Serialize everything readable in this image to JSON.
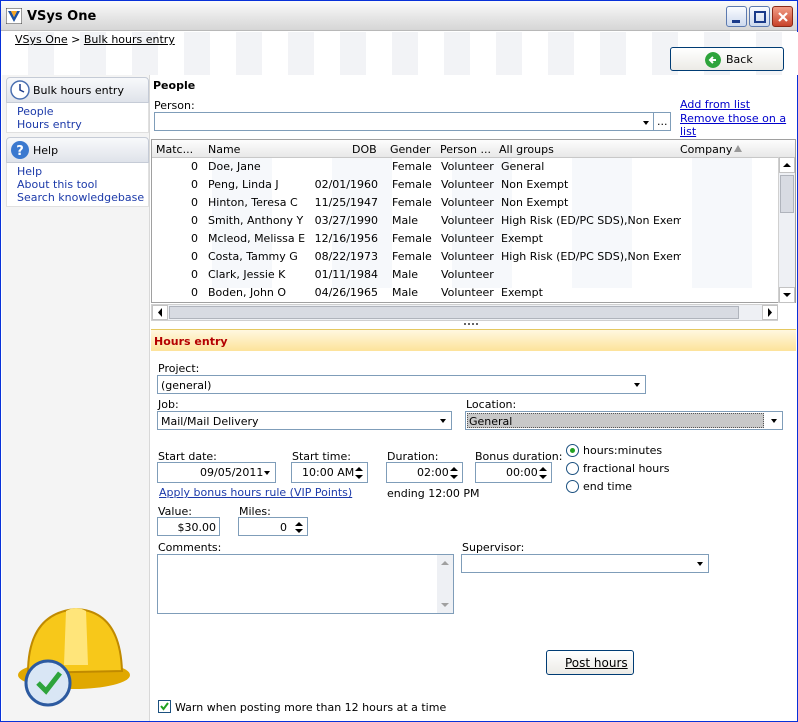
{
  "window": {
    "title": "VSys One"
  },
  "breadcrumb": {
    "root": "VSys One",
    "separator": ">",
    "current": "Bulk hours entry"
  },
  "toolbar": {
    "back_label": "Back"
  },
  "sidebar": {
    "sections": [
      {
        "title": "Bulk hours entry",
        "icon": "clock-icon",
        "links": [
          "People",
          "Hours entry"
        ]
      },
      {
        "title": "Help",
        "icon": "help-icon",
        "links": [
          "Help",
          "About this tool",
          "Search knowledgebase"
        ]
      }
    ]
  },
  "people": {
    "title": "People",
    "person_label": "Person:",
    "person_value": "",
    "more_label": "...",
    "add_from_list": "Add from list",
    "remove_on_list": "Remove those on a list",
    "columns": [
      "Matc...",
      "Name",
      "DOB",
      "Gender",
      "Person ...",
      "All groups",
      "Company"
    ],
    "rows": [
      {
        "match": "0",
        "name": "Doe, Jane",
        "dob": "",
        "gender": "Female",
        "type": "Volunteer",
        "groups": "General",
        "company": ""
      },
      {
        "match": "0",
        "name": "Peng, Linda J",
        "dob": "02/01/1960",
        "gender": "Female",
        "type": "Volunteer",
        "groups": "Non Exempt",
        "company": ""
      },
      {
        "match": "0",
        "name": "Hinton, Teresa C",
        "dob": "11/25/1947",
        "gender": "Female",
        "type": "Volunteer",
        "groups": "Non Exempt",
        "company": ""
      },
      {
        "match": "0",
        "name": "Smith, Anthony Y",
        "dob": "03/27/1990",
        "gender": "Male",
        "type": "Volunteer",
        "groups": "High Risk (ED/PC SDS),Non Exempt",
        "company": ""
      },
      {
        "match": "0",
        "name": "Mcleod, Melissa E",
        "dob": "12/16/1956",
        "gender": "Female",
        "type": "Volunteer",
        "groups": "Exempt",
        "company": ""
      },
      {
        "match": "0",
        "name": "Costa, Tammy G",
        "dob": "08/22/1973",
        "gender": "Female",
        "type": "Volunteer",
        "groups": "High Risk (ED/PC SDS),Non Exempt",
        "company": ""
      },
      {
        "match": "0",
        "name": "Clark, Jessie K",
        "dob": "01/11/1984",
        "gender": "Male",
        "type": "Volunteer",
        "groups": "",
        "company": ""
      },
      {
        "match": "0",
        "name": "Boden, John O",
        "dob": "04/26/1965",
        "gender": "Male",
        "type": "Volunteer",
        "groups": "Exempt",
        "company": ""
      }
    ]
  },
  "hours": {
    "title": "Hours entry",
    "project_label": "Project:",
    "project_value": "(general)",
    "job_label": "Job:",
    "job_value": "Mail/Mail Delivery",
    "location_label": "Location:",
    "location_value": "General",
    "start_date_label": "Start date:",
    "start_date_value": "09/05/2011",
    "start_time_label": "Start time:",
    "start_time_value": "10:00 AM",
    "duration_label": "Duration:",
    "duration_value": "02:00",
    "bonus_label": "Bonus duration:",
    "bonus_value": "00:00",
    "ending_text": "ending 12:00 PM",
    "bonus_rule_link": "Apply bonus hours rule (VIP Points)",
    "radio_options": [
      "hours:minutes",
      "fractional hours",
      "end time"
    ],
    "radio_selected": "hours:minutes",
    "value_label": "Value:",
    "value_value": "$30.00",
    "miles_label": "Miles:",
    "miles_value": "0",
    "comments_label": "Comments:",
    "comments_value": "",
    "supervisor_label": "Supervisor:",
    "supervisor_value": "",
    "post_label": "Post hours",
    "warn_label": "Warn when posting more than 12 hours at a time",
    "warn_checked": true
  },
  "colors": {
    "accent": "#b40000",
    "link": "#1c3aa9",
    "band": "#fde39a"
  }
}
